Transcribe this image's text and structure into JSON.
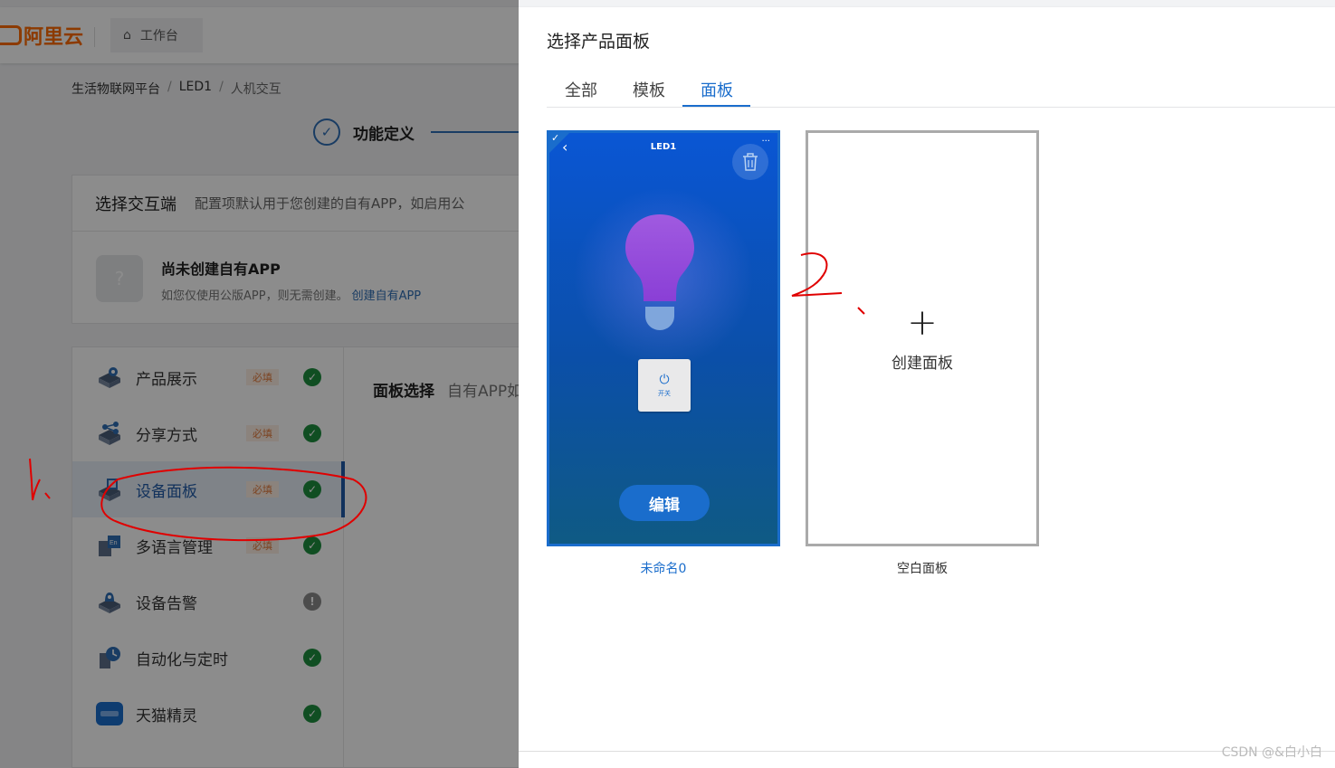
{
  "header": {
    "logo_text": "阿里云",
    "workbench_label": "工作台"
  },
  "breadcrumb": [
    "生活物联网平台",
    "LED1",
    "人机交互"
  ],
  "breadcrumb_sep": "/",
  "step": {
    "check": "✓",
    "label": "功能定义"
  },
  "interaction": {
    "title": "选择交互端",
    "desc": "配置项默认用于您创建的自有APP，如启用公",
    "app_icon": "?",
    "app_title": "尚未创建自有APP",
    "app_desc": "如您仅使用公版APP，则无需创建。",
    "create_link": "创建自有APP"
  },
  "menu": {
    "required_label": "必填",
    "items": [
      {
        "label": "产品展示",
        "required": true,
        "status": "ok",
        "icon": "product-display-icon"
      },
      {
        "label": "分享方式",
        "required": true,
        "status": "ok",
        "icon": "share-icon"
      },
      {
        "label": "设备面板",
        "required": true,
        "status": "ok",
        "icon": "device-panel-icon"
      },
      {
        "label": "多语言管理",
        "required": true,
        "status": "ok",
        "icon": "language-icon"
      },
      {
        "label": "设备告警",
        "required": false,
        "status": "warn",
        "icon": "alarm-icon"
      },
      {
        "label": "自动化与定时",
        "required": false,
        "status": "ok",
        "icon": "automation-icon"
      },
      {
        "label": "天猫精灵",
        "required": false,
        "status": "ok",
        "icon": "tmall-genie-icon"
      }
    ],
    "status_ok_glyph": "✓",
    "status_warn_glyph": "!"
  },
  "panel_select": {
    "title": "面板选择",
    "desc": "自有APP如"
  },
  "drawer": {
    "title": "选择产品面板",
    "tabs": [
      "全部",
      "模板",
      "面板"
    ],
    "active_tab": 2,
    "cards": [
      {
        "phone_title": "LED1",
        "switch_label": "开关",
        "edit_label": "编辑",
        "caption": "未命名0",
        "selected": true
      },
      {
        "plus": "+",
        "create_label": "创建面板",
        "caption": "空白面板"
      }
    ]
  },
  "annotations": {
    "mark_1": "1、",
    "mark_2": "2、"
  },
  "watermark": "CSDN @&白小白",
  "colors": {
    "accent": "#1a6dcc",
    "brand": "#ff6a00",
    "ok": "#1e8e3e",
    "required_bg": "#fdeee4",
    "required_text": "#e27a3b",
    "annotation": "#e00000"
  }
}
